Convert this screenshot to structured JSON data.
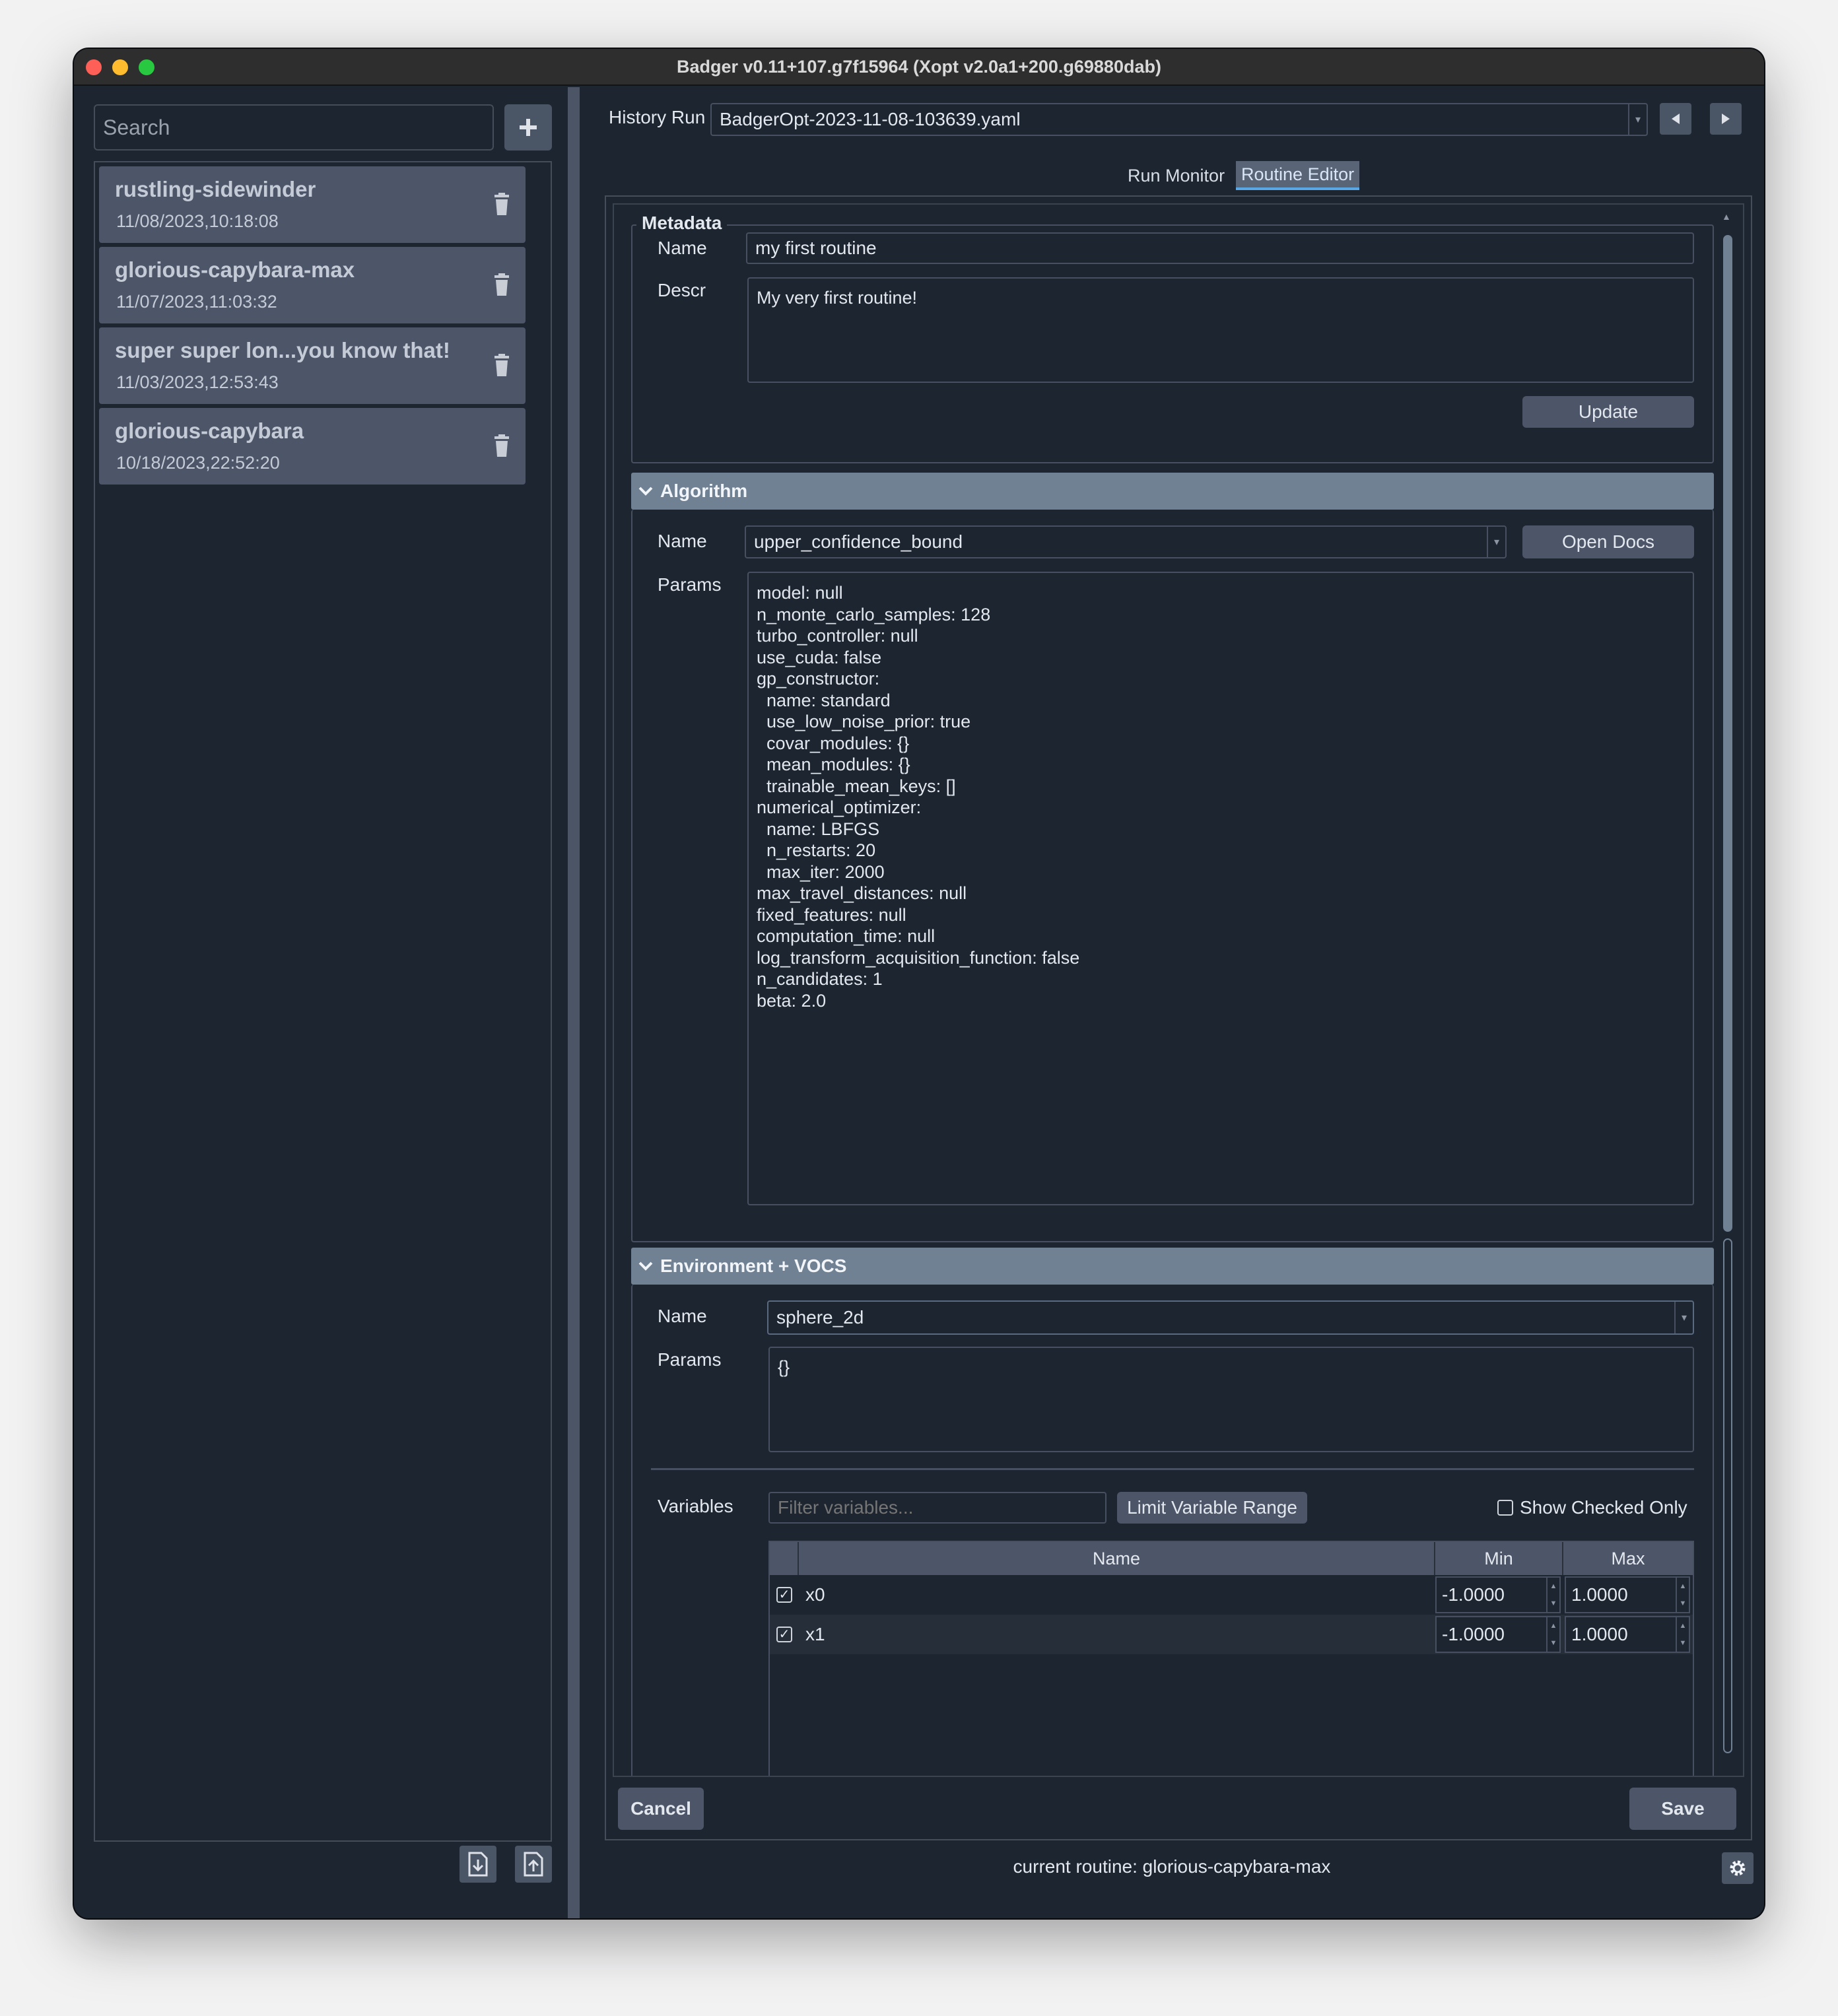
{
  "window": {
    "title": "Badger v0.11+107.g7f15964 (Xopt v2.0a1+200.g69880dab)"
  },
  "sidebar": {
    "search_placeholder": "Search",
    "add_icon": "plus-icon",
    "routines": [
      {
        "name": "rustling-sidewinder",
        "date": "11/08/2023,10:18:08"
      },
      {
        "name": "glorious-capybara-max",
        "date": "11/07/2023,11:03:32"
      },
      {
        "name": "super super lon...you know that!",
        "date": "11/03/2023,12:53:43"
      },
      {
        "name": "glorious-capybara",
        "date": "10/18/2023,22:52:20"
      }
    ],
    "bottom_buttons": [
      "import-icon",
      "export-icon"
    ]
  },
  "history": {
    "label": "History Run",
    "selected": "BadgerOpt-2023-11-08-103639.yaml"
  },
  "tabs": [
    {
      "label": "Run Monitor",
      "active": false
    },
    {
      "label": "Routine Editor",
      "active": true
    }
  ],
  "metadata": {
    "title": "Metadata",
    "name_label": "Name",
    "name_value": "my first routine",
    "descr_label": "Descr",
    "descr_value": "My very first routine!",
    "update_label": "Update"
  },
  "algorithm": {
    "title": "Algorithm",
    "name_label": "Name",
    "name_value": "upper_confidence_bound",
    "open_docs_label": "Open Docs",
    "params_label": "Params",
    "params_text": "model: null\nn_monte_carlo_samples: 128\nturbo_controller: null\nuse_cuda: false\ngp_constructor:\n  name: standard\n  use_low_noise_prior: true\n  covar_modules: {}\n  mean_modules: {}\n  trainable_mean_keys: []\nnumerical_optimizer:\n  name: LBFGS\n  n_restarts: 20\n  max_iter: 2000\nmax_travel_distances: null\nfixed_features: null\ncomputation_time: null\nlog_transform_acquisition_function: false\nn_candidates: 1\nbeta: 2.0"
  },
  "environment": {
    "title": "Environment + VOCS",
    "name_label": "Name",
    "name_value": "sphere_2d",
    "params_label": "Params",
    "params_value": "{}",
    "variables_label": "Variables",
    "filter_placeholder": "Filter variables...",
    "limit_range_label": "Limit Variable Range",
    "show_checked_label": "Show Checked Only",
    "show_checked": false,
    "columns": [
      "Name",
      "Min",
      "Max"
    ],
    "rows": [
      {
        "checked": true,
        "name": "x0",
        "min": "-1.0000",
        "max": "1.0000"
      },
      {
        "checked": true,
        "name": "x1",
        "min": "-1.0000",
        "max": "1.0000"
      }
    ]
  },
  "actions": {
    "cancel_label": "Cancel",
    "save_label": "Save"
  },
  "status": {
    "text": "current routine: glorious-capybara-max"
  },
  "colors": {
    "accent": "#5aa7e8",
    "panel": "#1d2530",
    "item": "#4d5669",
    "section_header": "#6f8193"
  }
}
